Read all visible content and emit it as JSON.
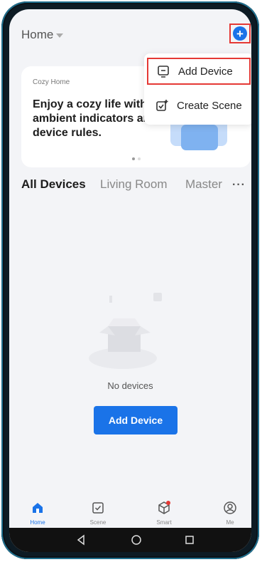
{
  "header": {
    "home_label": "Home"
  },
  "banner": {
    "small_title": "Cozy Home",
    "text": "Enjoy a cozy life with ambient indicators and device rules."
  },
  "popup": {
    "items": [
      {
        "label": "Add Device",
        "icon": "device-add-icon"
      },
      {
        "label": "Create Scene",
        "icon": "scene-add-icon"
      }
    ]
  },
  "tabs": [
    "All Devices",
    "Living Room",
    "Master"
  ],
  "empty": {
    "text": "No devices",
    "button_label": "Add Device"
  },
  "bottom_nav": [
    {
      "label": "Home",
      "icon": "home-icon",
      "active": true
    },
    {
      "label": "Scene",
      "icon": "scene-icon",
      "active": false
    },
    {
      "label": "Smart",
      "icon": "smart-icon",
      "active": false
    },
    {
      "label": "Me",
      "icon": "profile-icon",
      "active": false
    }
  ],
  "colors": {
    "accent": "#1a73e8",
    "highlight": "#e53935"
  }
}
